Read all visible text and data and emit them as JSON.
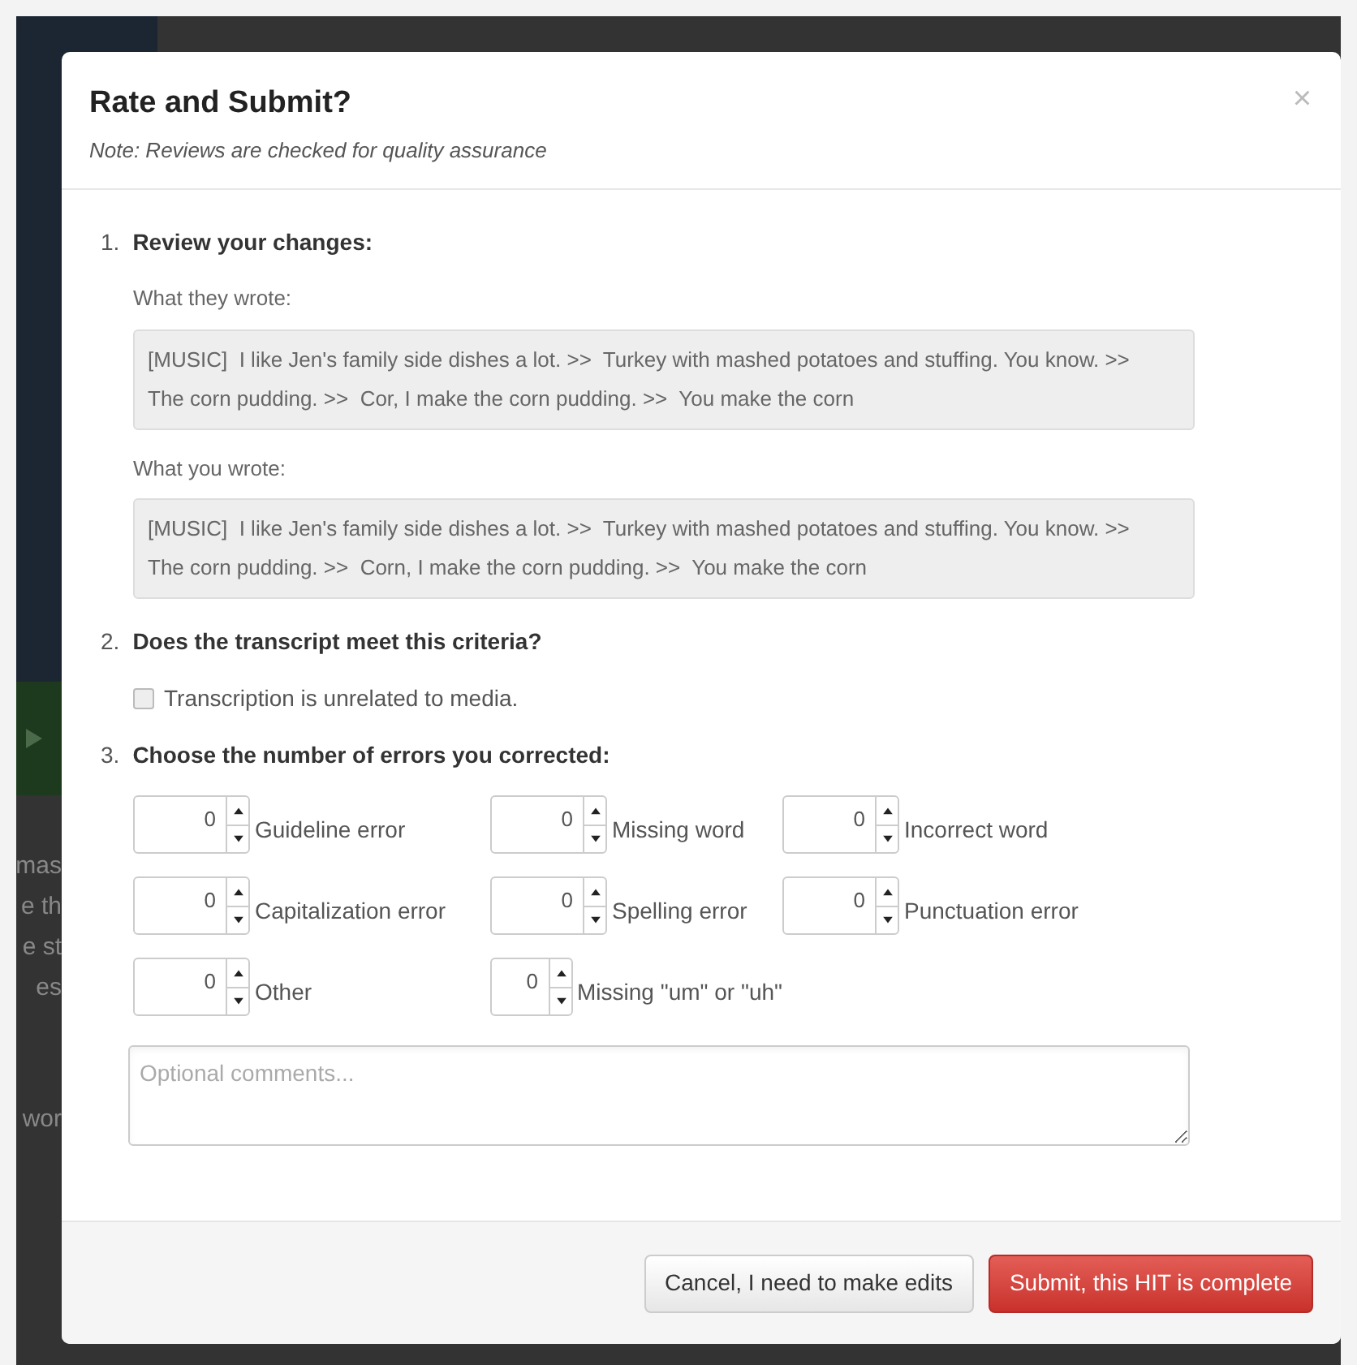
{
  "background_text": [
    "mas",
    "e th",
    "e st",
    "es",
    "wor"
  ],
  "dialog": {
    "title": "Rate and Submit?",
    "note": "Note: Reviews are checked for quality assurance",
    "close": "×"
  },
  "step1": {
    "number": "1.",
    "heading": "Review your changes:",
    "fields": [
      {
        "label": "What they wrote:",
        "value": "[MUSIC]  I like Jen's family side dishes a lot. >>  Turkey with mashed potatoes and stuffing. You know. >>  The corn pudding. >>  Cor, I make the corn pudding. >>  You make the corn"
      },
      {
        "label": "What you wrote:",
        "value": "[MUSIC]  I like Jen's family side dishes a lot. >>  Turkey with mashed potatoes and stuffing. You know. >>  The corn pudding. >>  Corn, I make the corn pudding. >>  You make the corn"
      }
    ]
  },
  "step2": {
    "number": "2.",
    "heading": "Does the transcript meet this criteria?",
    "checkbox": {
      "label": "Transcription is unrelated to media.",
      "checked": false
    }
  },
  "step3": {
    "number": "3.",
    "heading": "Choose the number of errors you corrected:",
    "counters": [
      {
        "value": "0",
        "label": "Guideline error"
      },
      {
        "value": "0",
        "label": "Missing word"
      },
      {
        "value": "0",
        "label": "Incorrect word"
      },
      {
        "value": "0",
        "label": "Capitalization error"
      },
      {
        "value": "0",
        "label": "Spelling error"
      },
      {
        "value": "0",
        "label": "Punctuation error"
      },
      {
        "value": "0",
        "label": "Other"
      },
      {
        "value": "0",
        "label": "Missing \"um\" or \"uh\""
      }
    ],
    "comments": {
      "placeholder": "Optional comments..."
    }
  },
  "buttons": [
    {
      "kind": "default",
      "label": "Cancel, I need to make edits"
    },
    {
      "kind": "danger",
      "label": "Submit, this HIT is complete"
    }
  ]
}
